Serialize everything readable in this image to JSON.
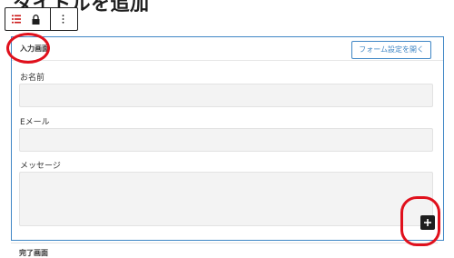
{
  "page": {
    "title": "タイトルを追加"
  },
  "toolbar": {
    "list_icon": "list-view-icon",
    "lock_icon": "lock-icon",
    "more_icon": "more-options-icon"
  },
  "form": {
    "section_label": "入力画面",
    "settings_button": "フォーム設定を開く",
    "fields": [
      {
        "label": "お名前"
      },
      {
        "label": "Eメール"
      },
      {
        "label": "メッセージ"
      }
    ],
    "inserter_icon": "plus-icon"
  },
  "complete_section": {
    "label": "完了画面"
  },
  "colors": {
    "accent": "#3f86c5",
    "annotation": "#e0101c",
    "toolbar_icon": "#cc1818"
  }
}
